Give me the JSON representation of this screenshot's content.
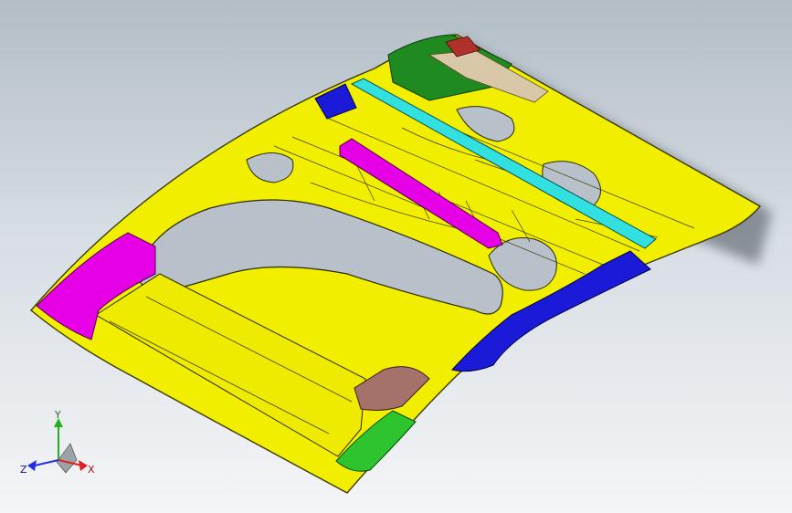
{
  "viewport": {
    "background_top": "#b3bdc6",
    "background_bottom": "#f4f5f7"
  },
  "model": {
    "primary_color": "#f2ee00",
    "part_colors": {
      "magenta": "#e600e6",
      "blue": "#1a1ad8",
      "cyan": "#33e0e0",
      "green": "#2ec42e",
      "dark_green": "#1f8a1f",
      "brown": "#a5716b",
      "tan": "#d8c8a8"
    }
  },
  "triad": {
    "x_label": "X",
    "y_label": "Y",
    "z_label": "Z",
    "x_color": "#e02020",
    "y_color": "#20b020",
    "z_color": "#2030e0"
  }
}
